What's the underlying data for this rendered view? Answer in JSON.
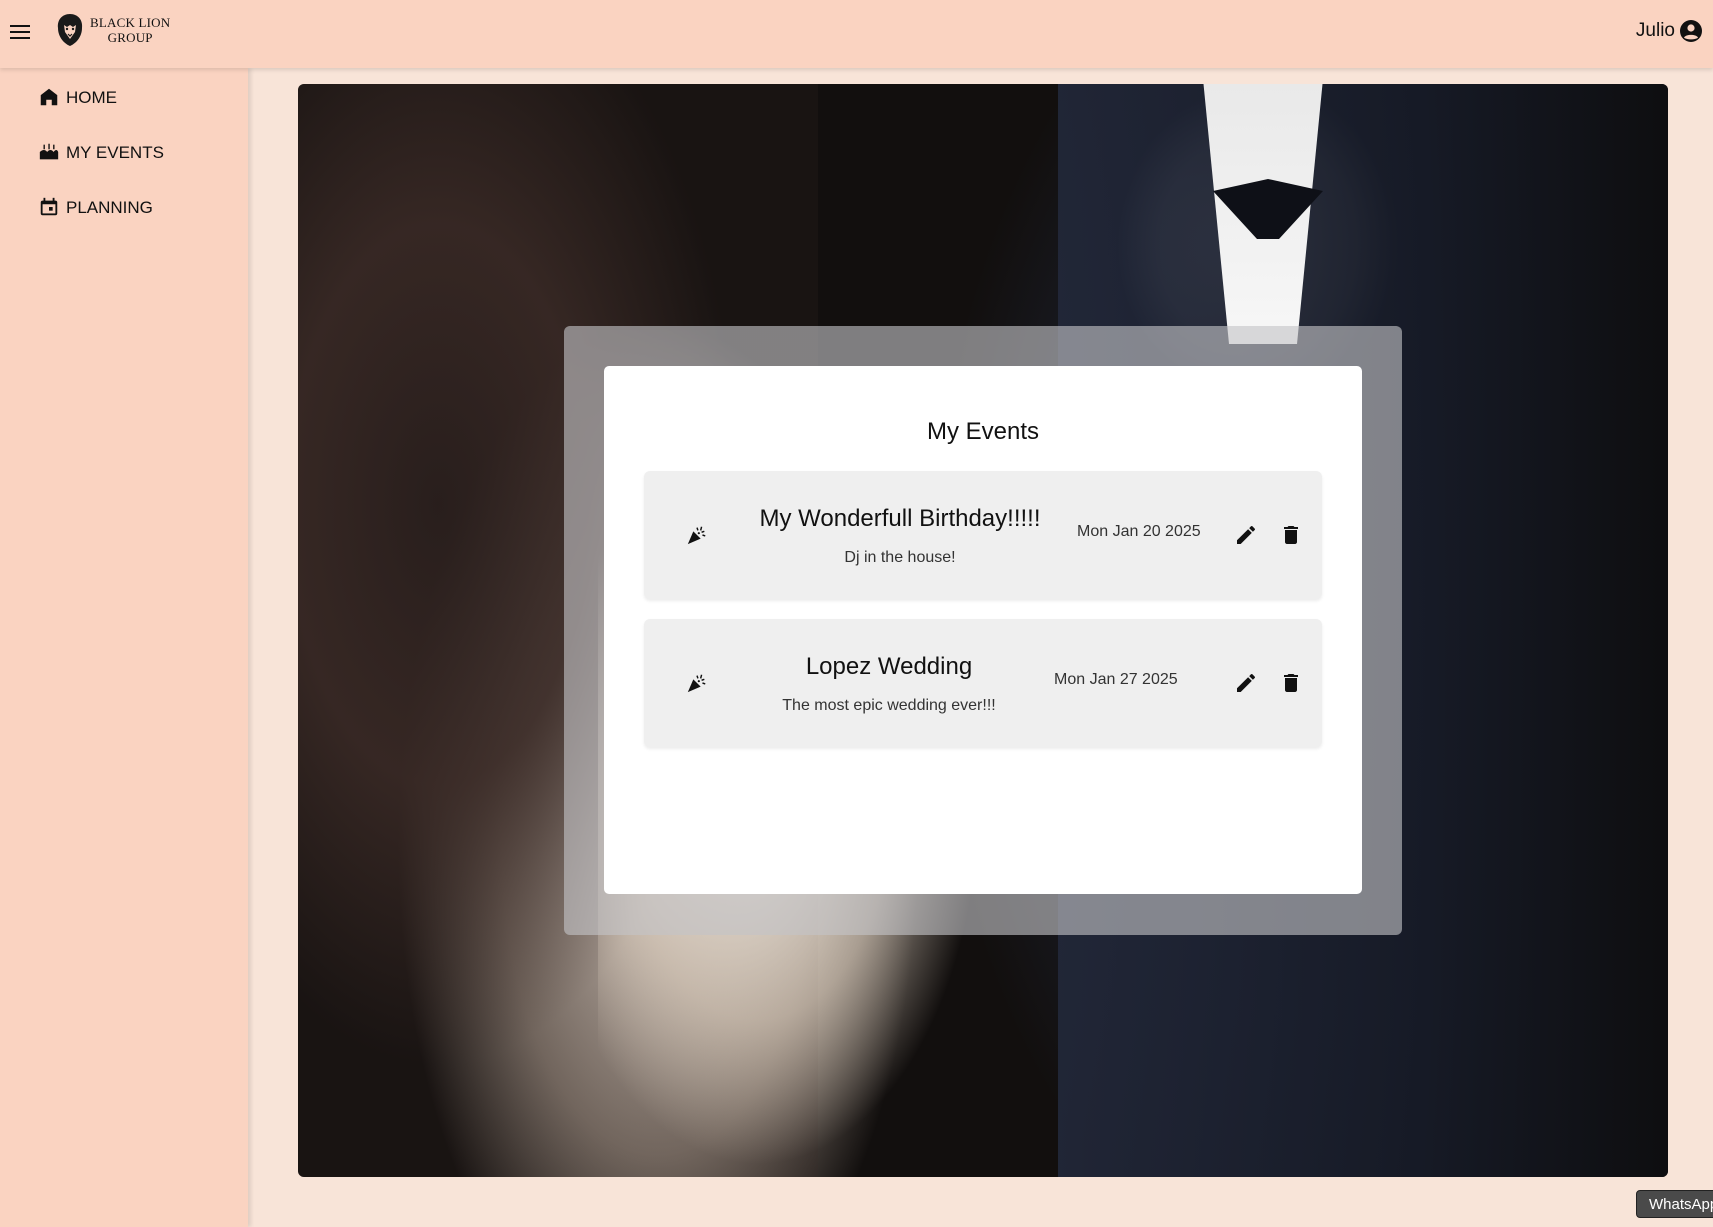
{
  "app": {
    "logo_line1": "BLACK LION",
    "logo_line2": "GROUP"
  },
  "header": {
    "user_name": "Julio"
  },
  "sidebar": {
    "items": [
      {
        "label": "HOME",
        "icon": "home-icon"
      },
      {
        "label": "MY EVENTS",
        "icon": "events-icon"
      },
      {
        "label": "PLANNING",
        "icon": "calendar-icon"
      }
    ]
  },
  "main": {
    "title": "My Events",
    "events": [
      {
        "title": "My Wonderfull Birthday!!!!!",
        "description": "Dj in the house!",
        "date": "Mon Jan 20 2025"
      },
      {
        "title": "Lopez Wedding",
        "description": "The most epic wedding ever!!!",
        "date": "Mon Jan 27 2025"
      }
    ]
  },
  "widgets": {
    "whatsapp_label": "WhatsApp"
  },
  "colors": {
    "header_bg": "#fad3c1",
    "page_bg": "#f8e4d8",
    "event_bg": "#efefef"
  }
}
